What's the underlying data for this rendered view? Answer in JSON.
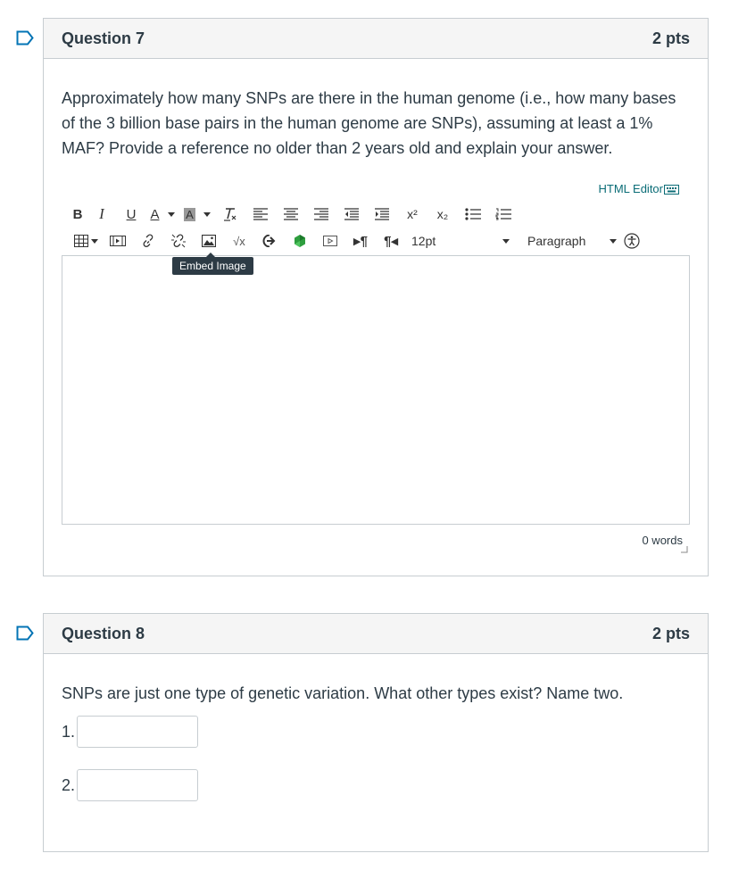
{
  "questions": [
    {
      "title": "Question 7",
      "points": "2 pts",
      "text": "Approximately how many SNPs are there in the human genome (i.e., how many bases of the 3 billion base pairs in the human genome are SNPs), assuming at least a 1% MAF? Provide a reference no older than 2 years old and explain your answer.",
      "html_editor_label": "HTML Editor",
      "font_size": "12pt",
      "block_format": "Paragraph",
      "tooltip": "Embed Image",
      "word_count": "0 words"
    },
    {
      "title": "Question 8",
      "points": "2 pts",
      "text": "SNPs are just one type of genetic variation. What other types exist? Name two.",
      "answers": [
        {
          "label": "1.",
          "value": ""
        },
        {
          "label": "2.",
          "value": ""
        }
      ]
    }
  ],
  "toolbar": {
    "bold": "B",
    "italic": "I",
    "underline": "U",
    "text_color": "A",
    "bg_color": "A",
    "superscript": "x²",
    "subscript": "x₂"
  },
  "colors": {
    "accent": "#0b6d77",
    "flag": "#0374b5",
    "border": "#c7cdd1",
    "header_bg": "#f5f5f5"
  }
}
